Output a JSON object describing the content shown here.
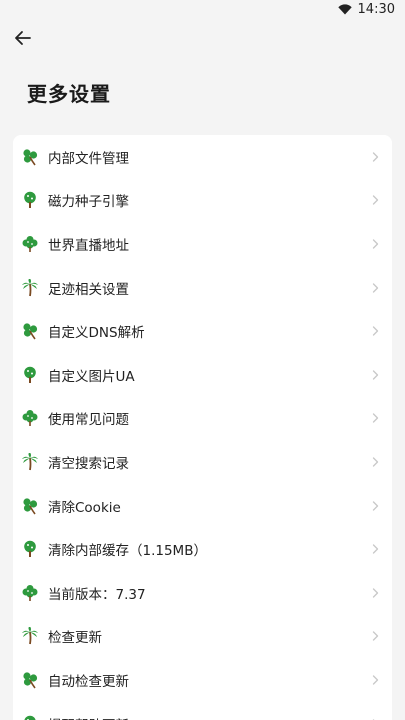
{
  "status_bar": {
    "time": "14:30",
    "wifi_icon": "wifi-icon"
  },
  "header": {
    "back_icon": "arrow-left-icon",
    "title": "更多设置"
  },
  "settings": {
    "items": [
      {
        "label": "内部文件管理",
        "icon": "clover-icon"
      },
      {
        "label": "磁力种子引擎",
        "icon": "tree-icon"
      },
      {
        "label": "世界直播地址",
        "icon": "bush-icon"
      },
      {
        "label": "足迹相关设置",
        "icon": "palm-tree-icon"
      },
      {
        "label": "自定义DNS解析",
        "icon": "clover-icon"
      },
      {
        "label": "自定义图片UA",
        "icon": "tree-icon"
      },
      {
        "label": "使用常见问题",
        "icon": "bush-icon"
      },
      {
        "label": "清空搜索记录",
        "icon": "palm-tree-icon"
      },
      {
        "label": "清除Cookie",
        "icon": "clover-icon"
      },
      {
        "label": "清除内部缓存（1.15MB）",
        "icon": "tree-icon"
      },
      {
        "label": "当前版本：7.37",
        "icon": "bush-icon"
      },
      {
        "label": "检查更新",
        "icon": "palm-tree-icon"
      },
      {
        "label": "自动检查更新",
        "icon": "clover-icon"
      },
      {
        "label": "提醒帮助更新",
        "icon": "tree-icon"
      }
    ],
    "chevron_icon": "chevron-right-icon"
  },
  "colors": {
    "leaf_green": "#2e9a3e",
    "trunk_brown": "#7a4a22",
    "background": "#f4f4f4",
    "card": "#ffffff"
  }
}
